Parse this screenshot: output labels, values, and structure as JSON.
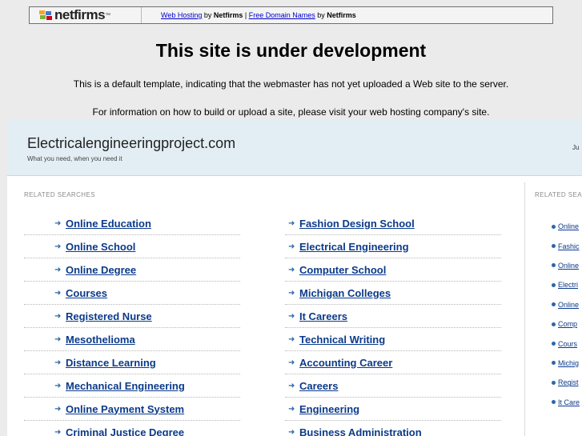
{
  "netfirms": {
    "logo": "netfirms",
    "link1": "Web Hosting",
    "by1": " by ",
    "brand1": "Netfirms",
    "sep": " | ",
    "link2": "Free Domain Names",
    "by2": " by ",
    "brand2": "Netfirms"
  },
  "notice": {
    "title": "This site is under development",
    "line1": "This is a default template, indicating that the webmaster has not yet uploaded a Web site to the server.",
    "line2": "For information on how to build or upload a site, please visit your web hosting company's site."
  },
  "parked": {
    "site_name": "Electricalengineeringproject.com",
    "tagline": "What you need, when you need it",
    "top_right": "Ju",
    "related_heading": "RELATED SEARCHES",
    "side_heading": "RELATED SEA",
    "left_column": [
      "Online Education",
      "Online School",
      "Online Degree",
      "Courses",
      "Registered Nurse",
      "Mesothelioma",
      "Distance Learning",
      "Mechanical Engineering",
      "Online Payment System",
      "Criminal Justice Degree"
    ],
    "right_column": [
      "Fashion Design School",
      "Electrical Engineering",
      "Computer School",
      "Michigan Colleges",
      "It Careers",
      "Technical Writing",
      "Accounting Career",
      "Careers",
      "Engineering",
      "Business Administration"
    ],
    "side_items": [
      "Online",
      "Fashic",
      "Online",
      "Electri",
      "Online",
      "Comp",
      "Cours",
      "Michig",
      "Regist",
      "It Care"
    ]
  },
  "colors": {
    "page_bg": "#ebebeb",
    "header_bg": "#e3eef4",
    "link": "#0b3a8a",
    "arrow": "#2c66a8"
  },
  "icons": {
    "list_bullet": "arrow-right-icon",
    "side_bullet": "dot-icon",
    "logo_mark": "netfirms-flag-icon"
  }
}
